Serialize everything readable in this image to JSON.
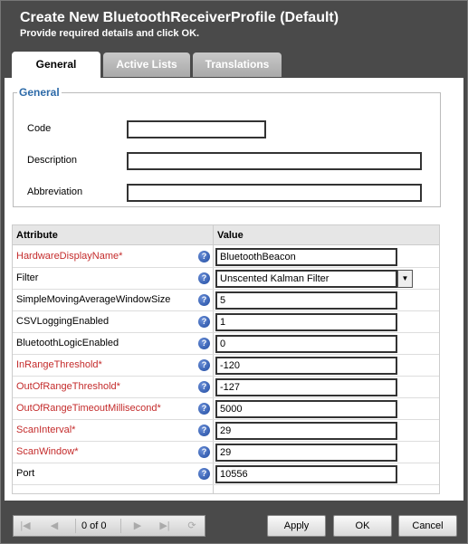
{
  "dialog": {
    "title": "Create New BluetoothReceiverProfile (Default)",
    "subtitle": "Provide required details and click OK."
  },
  "tabs": [
    {
      "label": "General",
      "active": true
    },
    {
      "label": "Active Lists",
      "active": false
    },
    {
      "label": "Translations",
      "active": false
    }
  ],
  "general": {
    "legend": "General",
    "code_label": "Code",
    "code_value": "",
    "description_label": "Description",
    "description_value": "",
    "abbreviation_label": "Abbreviation",
    "abbreviation_value": ""
  },
  "grid": {
    "headers": {
      "attribute": "Attribute",
      "value": "Value"
    },
    "help_glyph": "?",
    "rows": [
      {
        "attribute": "HardwareDisplayName*",
        "value": "BluetoothBeacon",
        "required": true
      },
      {
        "attribute": "Filter",
        "value": "Unscented Kalman Filter",
        "required": false,
        "dropdown": true
      },
      {
        "attribute": "SimpleMovingAverageWindowSize",
        "value": "5",
        "required": false
      },
      {
        "attribute": "CSVLoggingEnabled",
        "value": "1",
        "required": false
      },
      {
        "attribute": "BluetoothLogicEnabled",
        "value": "0",
        "required": false
      },
      {
        "attribute": "InRangeThreshold*",
        "value": "-120",
        "required": true
      },
      {
        "attribute": "OutOfRangeThreshold*",
        "value": "-127",
        "required": true
      },
      {
        "attribute": "OutOfRangeTimeoutMillisecond*",
        "value": "5000",
        "required": true
      },
      {
        "attribute": "ScanInterval*",
        "value": "29",
        "required": true
      },
      {
        "attribute": "ScanWindow*",
        "value": "29",
        "required": true
      },
      {
        "attribute": "Port",
        "value": "10556",
        "required": false
      }
    ]
  },
  "pager": {
    "text": "0 of 0"
  },
  "buttons": {
    "apply": "Apply",
    "ok": "OK",
    "cancel": "Cancel"
  },
  "colors": {
    "header": "#4a4a4a",
    "required": "#c42b2b",
    "legend": "#2d6aa8"
  }
}
